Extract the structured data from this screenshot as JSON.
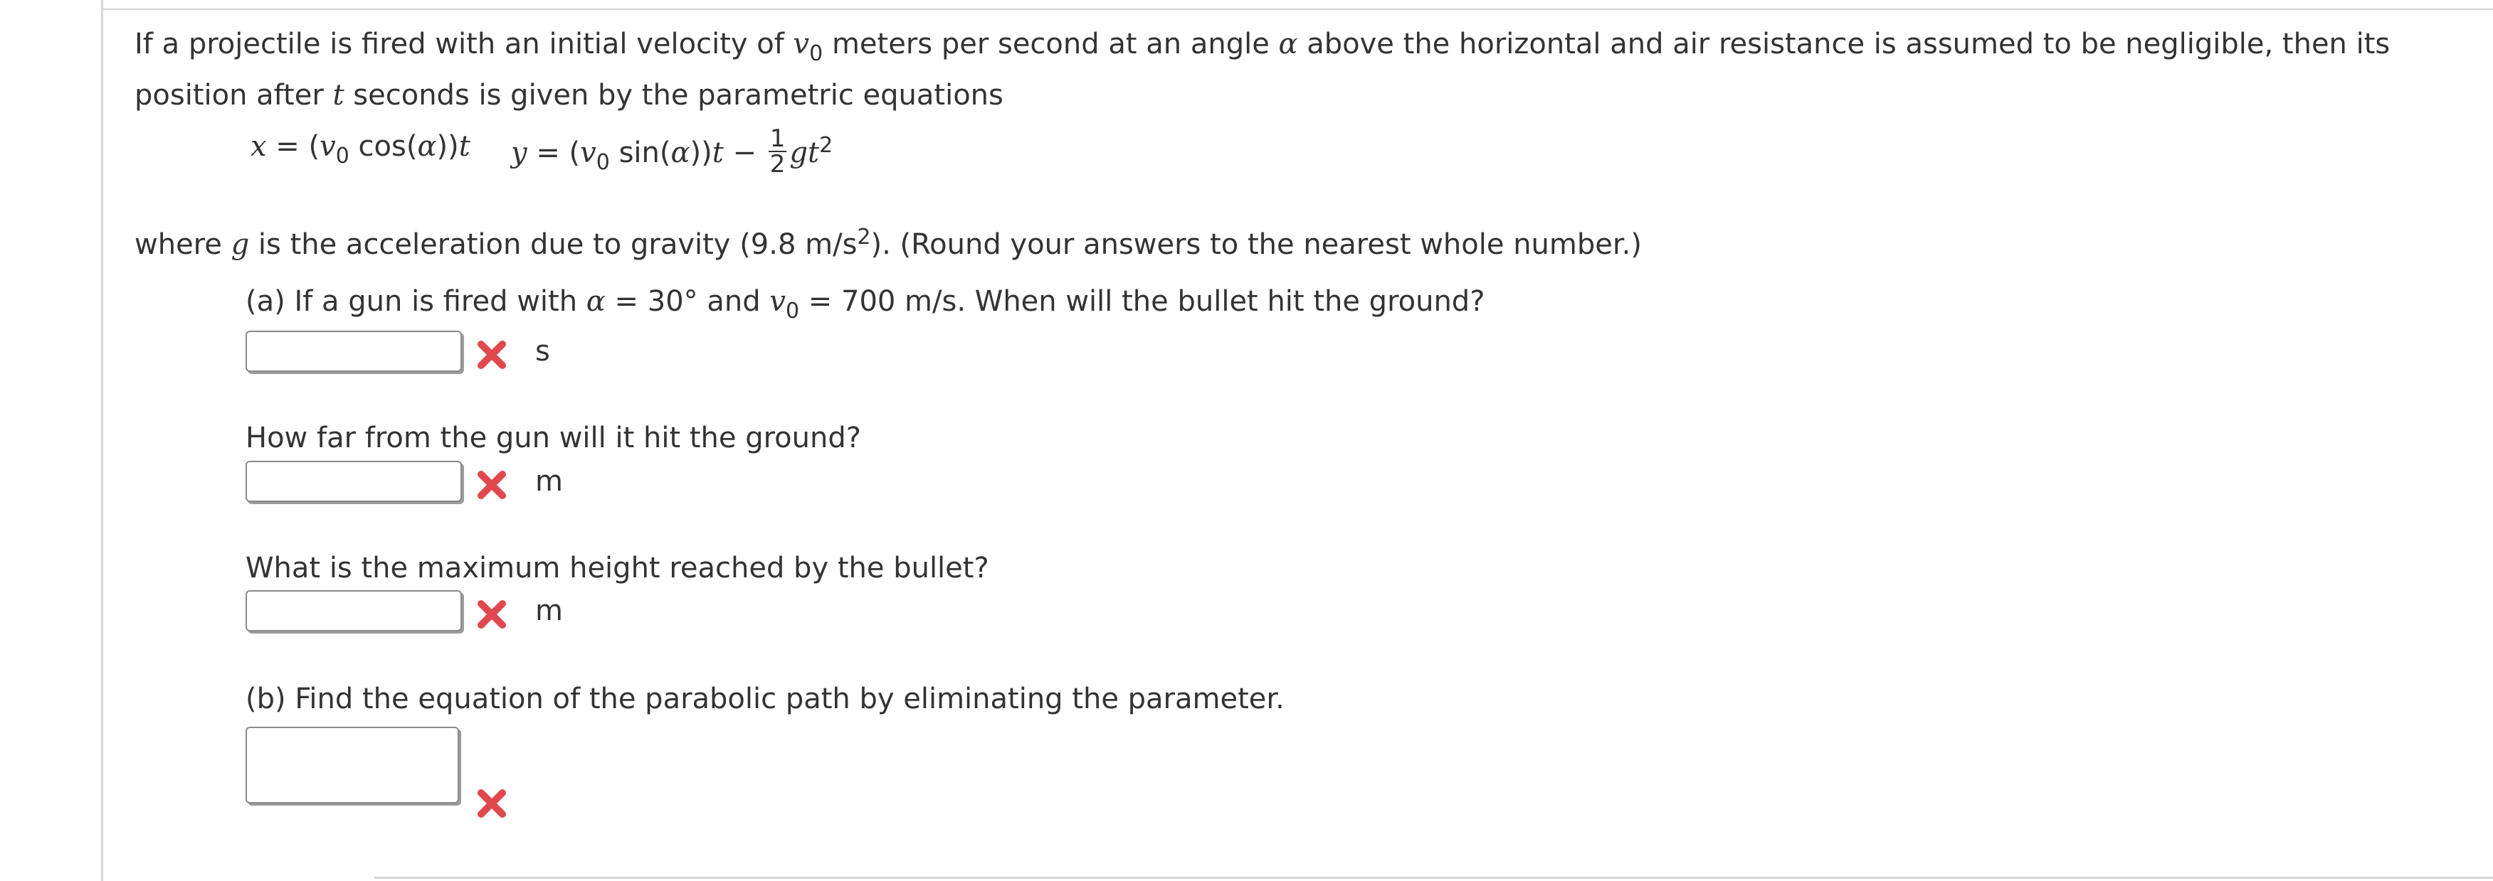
{
  "problem": {
    "intro_line1_a": "If a projectile is fired with an initial velocity of ",
    "intro_line1_var": "v",
    "intro_line1_sub": "0",
    "intro_line1_b": " meters per second at an angle ",
    "intro_line1_alpha": "α",
    "intro_line1_c": " above the horizontal and air resistance is assumed to be negligible, then its",
    "intro_line2_a": "position after ",
    "intro_line2_t": "t",
    "intro_line2_b": " seconds is given by the parametric equations",
    "eq_x": {
      "x": "x",
      "eq1": " = (",
      "v": "v",
      "sub": "0",
      "cos": " cos(",
      "alpha": "α",
      "close": "))",
      "t": "t"
    },
    "eq_y": {
      "y": "y",
      "eq1": " = (",
      "v": "v",
      "sub": "0",
      "sin": " sin(",
      "alpha": "α",
      "close": "))",
      "t": "t",
      "minus": " − ",
      "frac_num": "1",
      "frac_den": "2",
      "g": "g",
      "t2": "t",
      "exp": "2"
    },
    "intro_line3_a": "where ",
    "intro_line3_g": "g",
    "intro_line3_b": " is the acceleration due to gravity (9.8 m/s",
    "intro_line3_sup": "2",
    "intro_line3_c": "). (Round your answers to the nearest whole number.)"
  },
  "part_a": {
    "prompt_a": "(a) If a gun is fired with ",
    "alpha": "α",
    "prompt_b": " = 30° and ",
    "v": "v",
    "sub": "0",
    "prompt_c": " = 700 m/s. When will the bullet hit the ground?",
    "unit": "s",
    "value": ""
  },
  "question_distance": {
    "prompt": "How far from the gun will it hit the ground?",
    "unit": "m",
    "value": ""
  },
  "question_height": {
    "prompt": "What is the maximum height reached by the bullet?",
    "unit": "m",
    "value": ""
  },
  "part_b": {
    "prompt": "(b) Find the equation of the parabolic path by eliminating the parameter.",
    "value": ""
  },
  "colors": {
    "incorrect_mark": "#e0484e",
    "text": "#333333",
    "border": "#d6d6d6"
  },
  "icons": {
    "incorrect": "x-mark-icon"
  }
}
